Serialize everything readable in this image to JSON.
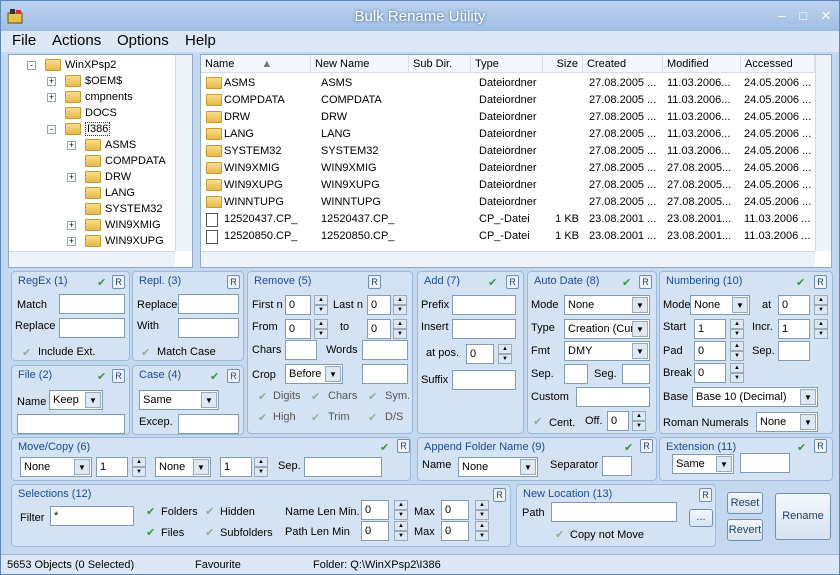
{
  "app": {
    "title": "Bulk Rename Utility"
  },
  "window_buttons": {
    "min": "–",
    "max": "□",
    "close": "✕"
  },
  "menu": [
    "File",
    "Actions",
    "Options",
    "Help"
  ],
  "tree": [
    {
      "label": "WinXPsp2",
      "level": 0,
      "exp": "-"
    },
    {
      "label": "$OEM$",
      "level": 1,
      "exp": "+"
    },
    {
      "label": "cmpnents",
      "level": 1,
      "exp": "+"
    },
    {
      "label": "DOCS",
      "level": 1,
      "exp": ""
    },
    {
      "label": "I386",
      "level": 1,
      "exp": "-"
    },
    {
      "label": "ASMS",
      "level": 2,
      "exp": "+"
    },
    {
      "label": "COMPDATA",
      "level": 2,
      "exp": ""
    },
    {
      "label": "DRW",
      "level": 2,
      "exp": "+"
    },
    {
      "label": "LANG",
      "level": 2,
      "exp": ""
    },
    {
      "label": "SYSTEM32",
      "level": 2,
      "exp": ""
    },
    {
      "label": "WIN9XMIG",
      "level": 2,
      "exp": "+"
    },
    {
      "label": "WIN9XUPG",
      "level": 2,
      "exp": "+"
    },
    {
      "label": "WINNTUPG",
      "level": 2,
      "exp": "+"
    }
  ],
  "columns": [
    "Name",
    "New Name",
    "Sub Dir.",
    "Type",
    "Size",
    "Created",
    "Modified",
    "Accessed"
  ],
  "files": [
    {
      "icon": "folder",
      "name": "ASMS",
      "newname": "ASMS",
      "subdir": "",
      "type": "Dateiordner",
      "size": "",
      "created": "27.08.2005 ...",
      "modified": "11.03.2006...",
      "accessed": "24.05.2006 ..."
    },
    {
      "icon": "folder",
      "name": "COMPDATA",
      "newname": "COMPDATA",
      "subdir": "",
      "type": "Dateiordner",
      "size": "",
      "created": "27.08.2005 ...",
      "modified": "11.03.2006...",
      "accessed": "24.05.2006 ..."
    },
    {
      "icon": "folder",
      "name": "DRW",
      "newname": "DRW",
      "subdir": "",
      "type": "Dateiordner",
      "size": "",
      "created": "27.08.2005 ...",
      "modified": "11.03.2006...",
      "accessed": "24.05.2006 ..."
    },
    {
      "icon": "folder",
      "name": "LANG",
      "newname": "LANG",
      "subdir": "",
      "type": "Dateiordner",
      "size": "",
      "created": "27.08.2005 ...",
      "modified": "11.03.2006...",
      "accessed": "24.05.2006 ..."
    },
    {
      "icon": "folder",
      "name": "SYSTEM32",
      "newname": "SYSTEM32",
      "subdir": "",
      "type": "Dateiordner",
      "size": "",
      "created": "27.08.2005 ...",
      "modified": "11.03.2006...",
      "accessed": "24.05.2006 ..."
    },
    {
      "icon": "folder",
      "name": "WIN9XMIG",
      "newname": "WIN9XMIG",
      "subdir": "",
      "type": "Dateiordner",
      "size": "",
      "created": "27.08.2005 ...",
      "modified": "27.08.2005...",
      "accessed": "24.05.2006 ..."
    },
    {
      "icon": "folder",
      "name": "WIN9XUPG",
      "newname": "WIN9XUPG",
      "subdir": "",
      "type": "Dateiordner",
      "size": "",
      "created": "27.08.2005 ...",
      "modified": "27.08.2005...",
      "accessed": "24.05.2006 ..."
    },
    {
      "icon": "folder",
      "name": "WINNTUPG",
      "newname": "WINNTUPG",
      "subdir": "",
      "type": "Dateiordner",
      "size": "",
      "created": "27.08.2005 ...",
      "modified": "27.08.2005...",
      "accessed": "24.05.2006 ..."
    },
    {
      "icon": "file",
      "name": "12520437.CP_",
      "newname": "12520437.CP_",
      "subdir": "",
      "type": "CP_-Datei",
      "size": "1 KB",
      "created": "23.08.2001 ...",
      "modified": "23.08.2001...",
      "accessed": "11.03.2006 ..."
    },
    {
      "icon": "file",
      "name": "12520850.CP_",
      "newname": "12520850.CP_",
      "subdir": "",
      "type": "CP_-Datei",
      "size": "1 KB",
      "created": "23.08.2001 ...",
      "modified": "23.08.2001...",
      "accessed": "11.03.2006 ..."
    }
  ],
  "regex": {
    "title": "RegEx (1)",
    "r": "R",
    "match": "Match",
    "replace": "Replace",
    "include": "Include Ext."
  },
  "repl": {
    "title": "Repl. (3)",
    "replace": "Replace",
    "with": "With",
    "matchcase": "Match Case"
  },
  "remove": {
    "title": "Remove (5)",
    "firstn": "First n",
    "firstn_v": "0",
    "lastn": "Last n",
    "lastn_v": "0",
    "from": "From",
    "from_v": "0",
    "to": "to",
    "to_v": "0",
    "chars": "Chars",
    "words": "Words",
    "crop": "Crop",
    "crop_v": "Before",
    "digits": "Digits",
    "chars2": "Chars",
    "sym": "Sym.",
    "high": "High",
    "trim": "Trim",
    "ds": "D/S"
  },
  "add": {
    "title": "Add (7)",
    "prefix": "Prefix",
    "insert": "Insert",
    "atpos": "at pos.",
    "atpos_v": "0",
    "suffix": "Suffix"
  },
  "autodate": {
    "title": "Auto Date (8)",
    "mode": "Mode",
    "mode_v": "None",
    "type": "Type",
    "type_v": "Creation (Cur",
    "fmt": "Fmt",
    "fmt_v": "DMY",
    "sep": "Sep.",
    "seg": "Seg.",
    "custom": "Custom",
    "cent": "Cent.",
    "off": "Off.",
    "off_v": "0"
  },
  "numbering": {
    "title": "Numbering (10)",
    "mode": "Mode",
    "mode_v": "None",
    "at": "at",
    "at_v": "0",
    "start": "Start",
    "start_v": "1",
    "incr": "Incr.",
    "incr_v": "1",
    "pad": "Pad",
    "pad_v": "0",
    "sep": "Sep.",
    "brk": "Break",
    "brk_v": "0",
    "base": "Base",
    "base_v": "Base 10 (Decimal)",
    "roman": "Roman Numerals",
    "roman_v": "None"
  },
  "file": {
    "title": "File (2)",
    "name": "Name",
    "name_v": "Keep"
  },
  "case": {
    "title": "Case (4)",
    "case_v": "Same",
    "excep": "Excep."
  },
  "movecopy": {
    "title": "Move/Copy (6)",
    "sel1": "None",
    "num1": "1",
    "sel2": "None",
    "num2": "1",
    "sep": "Sep."
  },
  "appendfolder": {
    "title": "Append Folder Name (9)",
    "name": "Name",
    "name_v": "None",
    "separator": "Separator"
  },
  "extension": {
    "title": "Extension (11)",
    "ext_v": "Same"
  },
  "selections": {
    "title": "Selections (12)",
    "filter": "Filter",
    "filter_v": "*",
    "folders": "Folders",
    "hidden": "Hidden",
    "files": "Files",
    "subfolders": "Subfolders",
    "namelen": "Name Len Min.",
    "namelen_v": "0",
    "max": "Max",
    "max_v": "0",
    "pathlen": "Path Len Min",
    "pathlen_v": "0",
    "max2": "Max",
    "max2_v": "0"
  },
  "newloc": {
    "title": "New Location (13)",
    "path": "Path",
    "copynotmove": "Copy not Move",
    "browse": "..."
  },
  "buttons": {
    "reset": "Reset",
    "revert": "Revert",
    "rename": "Rename"
  },
  "status": {
    "objects": "5653 Objects (0 Selected)",
    "favourite": "Favourite",
    "folder": "Folder: Q:\\WinXPsp2\\I386"
  }
}
